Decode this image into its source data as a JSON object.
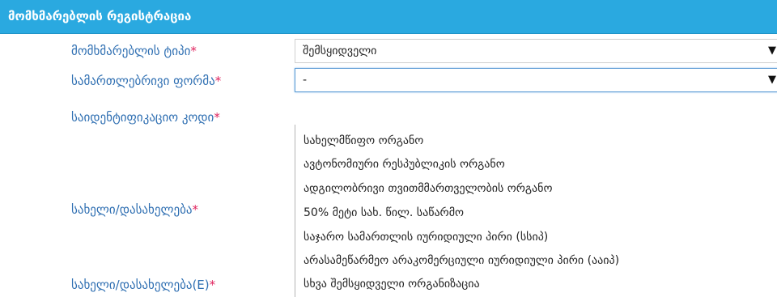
{
  "header": {
    "title": "მომხმარებლის რეგისტრაცია"
  },
  "fields": {
    "user_type": {
      "label": "მომხმარებლის ტიპი",
      "required_mark": "*",
      "value": "შემსყიდველი"
    },
    "legal_form": {
      "label": "სამართლებრივი ფორმა",
      "required_mark": "*",
      "value": "-",
      "options": [
        "სახელმწიფო ორგანო",
        "ავტონომიური რესპუბლიკის ორგანო",
        "ადგილობრივი თვითმმართველობის ორგანო",
        "50% მეტი სახ. წილ. საწარმო",
        "საჯარო სამართლის იურიდიული პირი (სსიპ)",
        "არასამეწარმეო არაკომერციული იურიდიული პირი (ააიპ)",
        "სხვა შემსყიდველი ორგანიზაცია"
      ]
    },
    "identification_code": {
      "label": "საიდენტიფიკაციო კოდი",
      "required_mark": "*"
    },
    "name": {
      "label": "სახელი/დასახელება",
      "required_mark": "*"
    },
    "name_en": {
      "label": "სახელი/დასახელება(E)",
      "required_mark": "*"
    }
  },
  "icons": {
    "dropdown_arrow": "▼"
  },
  "colors": {
    "header_bg": "#2aa9e0",
    "label_text": "#2f6fb2",
    "required_mark": "#e0245e"
  }
}
